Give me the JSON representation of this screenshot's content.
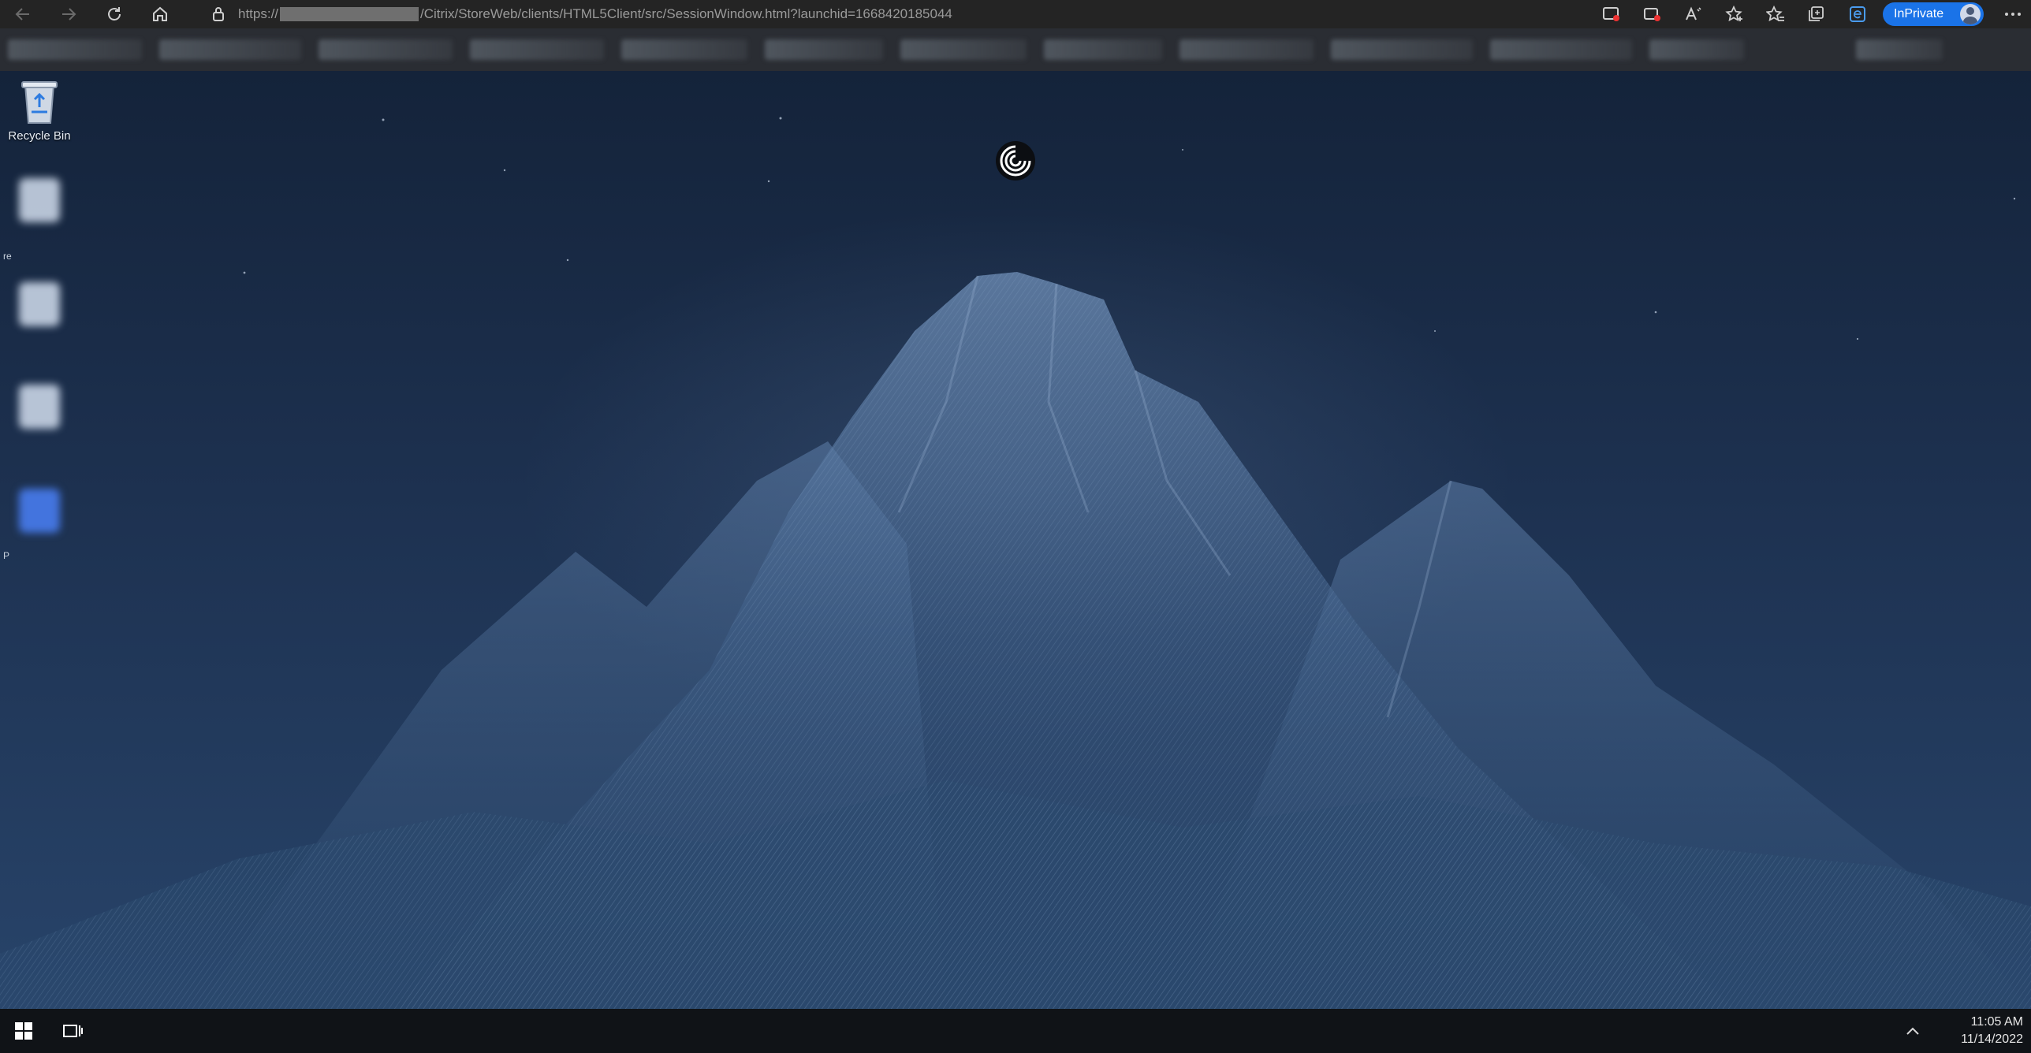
{
  "browser": {
    "url_prefix": "https://",
    "url_rest": "/Citrix/StoreWeb/clients/HTML5Client/src/SessionWindow.html?launchid=1668420185044",
    "inprivate_label": "InPrivate",
    "icons": [
      "back-icon",
      "forward-icon",
      "refresh-icon",
      "home-icon",
      "lock-icon",
      "screen-cast-icon",
      "camera-icon",
      "read-aloud-icon",
      "add-favorite-icon",
      "favorites-icon",
      "collections-icon",
      "edge-icon",
      "more-icon"
    ]
  },
  "desktop": {
    "icons": [
      {
        "label": "Recycle Bin"
      },
      {
        "label": ""
      },
      {
        "label": ""
      },
      {
        "label": ""
      },
      {
        "label": ""
      }
    ],
    "side_marks": [
      "re",
      "P"
    ]
  },
  "taskbar": {
    "time": "11:05 AM",
    "date": "11/14/2022"
  },
  "colors": {
    "inprivate": "#1a73e8",
    "taskbar": "#101317",
    "browser_bar": "#242424"
  }
}
